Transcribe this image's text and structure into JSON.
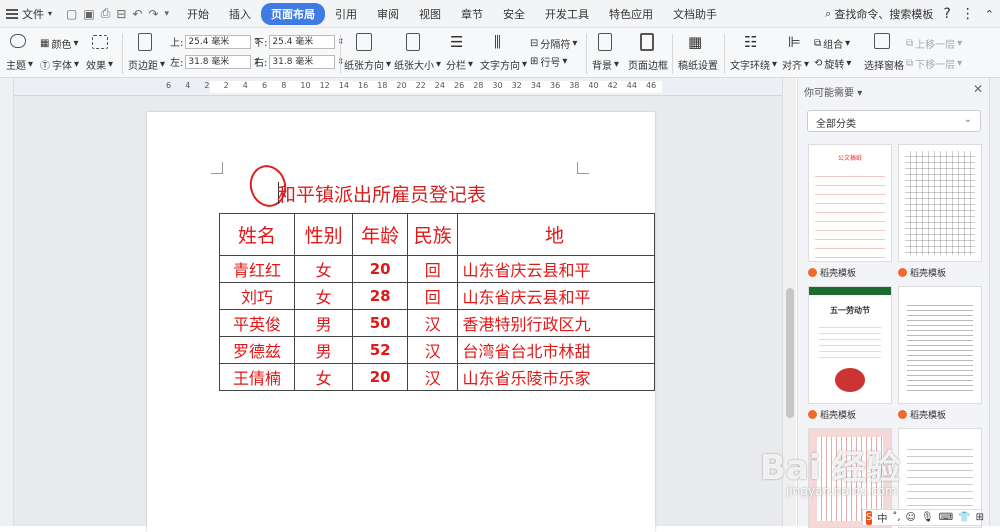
{
  "menubar": {
    "file_label": "文件",
    "tabs": [
      "开始",
      "插入",
      "页面布局",
      "引用",
      "审阅",
      "视图",
      "章节",
      "安全",
      "开发工具",
      "特色应用",
      "文档助手"
    ],
    "active_tab": "页面布局",
    "search_label": "查找命令、搜索模板",
    "help": "?"
  },
  "ribbon": {
    "theme": "主题",
    "colors": "颜色",
    "font": "字体",
    "effects": "效果",
    "margins": "页边距",
    "top_label": "上:",
    "top_value": "25.4 毫米",
    "bottom_label": "下:",
    "bottom_value": "25.4 毫米",
    "left_label": "左:",
    "left_value": "31.8 毫米",
    "right_label": "右:",
    "right_value": "31.8 毫米",
    "orientation": "纸张方向",
    "size": "纸张大小",
    "columns": "分栏",
    "text_direction": "文字方向",
    "separator": "分隔符",
    "line_number": "行号",
    "background": "背景",
    "page_border": "页面边框",
    "paper_settings": "稿纸设置",
    "text_wrap": "文字环绕",
    "align": "对齐",
    "group": "组合",
    "rotate": "旋转",
    "select_pane": "选择窗格",
    "bring_forward": "上移一层",
    "send_backward": "下移一层"
  },
  "ruler": {
    "ticks": [
      "6",
      "4",
      "2",
      "2",
      "4",
      "6",
      "8",
      "10",
      "12",
      "14",
      "16",
      "18",
      "20",
      "22",
      "24",
      "26",
      "28",
      "30",
      "32",
      "34",
      "36",
      "38",
      "40",
      "42",
      "44",
      "46"
    ]
  },
  "document": {
    "title": "和平镇派出所雇员登记表",
    "headers": [
      "姓名",
      "性别",
      "年龄",
      "民族",
      "地"
    ],
    "rows": [
      {
        "name": "青红红",
        "gender": "女",
        "age": "20",
        "ethnic": "回",
        "addr": "山东省庆云县和平"
      },
      {
        "name": "刘巧",
        "gender": "女",
        "age": "28",
        "ethnic": "回",
        "addr": "山东省庆云县和平"
      },
      {
        "name": "平英俊",
        "gender": "男",
        "age": "50",
        "ethnic": "汉",
        "addr": "香港特别行政区九"
      },
      {
        "name": "罗德兹",
        "gender": "男",
        "age": "52",
        "ethnic": "汉",
        "addr": "台湾省台北市林甜"
      },
      {
        "name": "王倩楠",
        "gender": "女",
        "age": "20",
        "ethnic": "汉",
        "addr": "山东省乐陵市乐家"
      }
    ]
  },
  "panel": {
    "title": "你可能需要",
    "category": "全部分类",
    "templates": [
      {
        "label": "稻壳模板",
        "caption": "公文稿纸"
      },
      {
        "label": "稻壳模板",
        "caption": ""
      },
      {
        "label": "稻壳模板",
        "caption": "五一劳动节"
      },
      {
        "label": "稻壳模板",
        "caption": ""
      }
    ]
  },
  "watermark": {
    "main": "Bai 经验",
    "sub": "jingyan.baidu.com"
  },
  "tray": {
    "ime": "S",
    "lang": "中"
  }
}
